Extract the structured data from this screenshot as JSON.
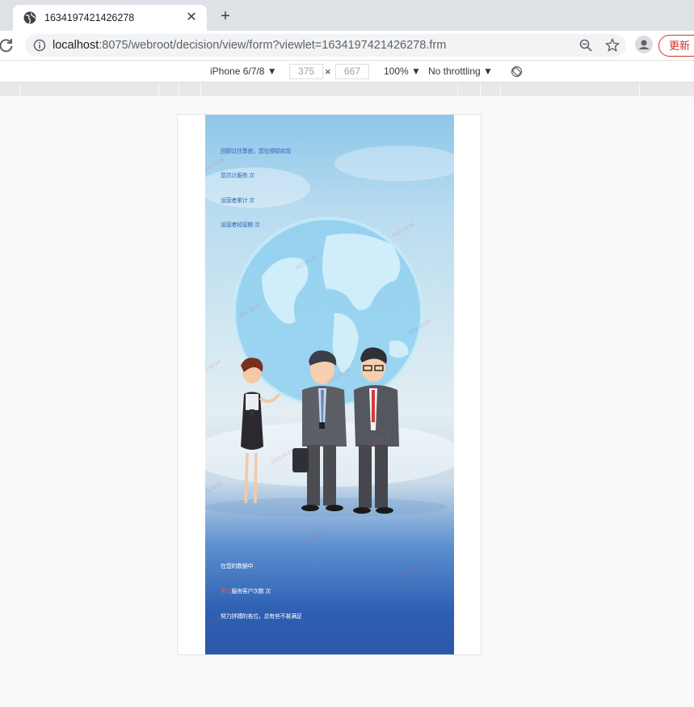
{
  "browser": {
    "tab_title": "1634197421426278",
    "tab_close": "✕",
    "new_tab": "+",
    "url_host": "localhost",
    "url_path": ":8075/webroot/decision/view/form?viewlet=1634197421426278.frm",
    "update_label": "更新"
  },
  "devtools": {
    "device": "iPhone 6/7/8 ▼",
    "width": "375",
    "height": "667",
    "times": "×",
    "zoom": "100% ▼",
    "throttling": "No throttling ▼"
  },
  "poster": {
    "line1": "回顾过往季度，您在顺德实现",
    "line2": "您共计服务 次",
    "line3": "运营者累计 次",
    "line4": "运营者经营额 次",
    "line5": "在您的数据中",
    "line6_hl": "累计",
    "line6": "服务客户次数 次",
    "line7": "努力拼搏的各位，总有些不甚满足",
    "watermark": "2021-10-14"
  },
  "colors": {
    "accent": "#2a66b8",
    "update": "#d93025",
    "highlight": "#e35a3a"
  }
}
